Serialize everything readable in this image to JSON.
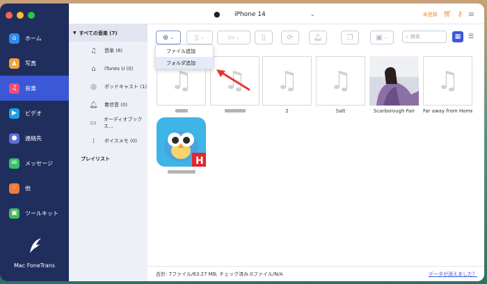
{
  "app": {
    "name": "Mac FoneTrans"
  },
  "device": {
    "name": "iPhone 14"
  },
  "topbar": {
    "unregistered": "未登録"
  },
  "nav": {
    "items": [
      {
        "label": "ホーム",
        "color": "#2f8bf0"
      },
      {
        "label": "写真",
        "color": "#f2a33a"
      },
      {
        "label": "音楽",
        "color": "#ec4f79"
      },
      {
        "label": "ビデオ",
        "color": "#1aa0e8"
      },
      {
        "label": "連絡先",
        "color": "#5b6ed8"
      },
      {
        "label": "メッセージ",
        "color": "#36c06b"
      },
      {
        "label": "他",
        "color": "#f27a3a"
      },
      {
        "label": "ツールキット",
        "color": "#43b85c"
      }
    ],
    "active_index": 2
  },
  "category": {
    "header": "すべての音楽 (7)",
    "items": [
      {
        "label": "音楽 (6)",
        "icon": "music-note-icon"
      },
      {
        "label": "iTunes U (0)",
        "icon": "graduation-cap-icon"
      },
      {
        "label": "ポッドキャスト (1)",
        "icon": "podcast-icon"
      },
      {
        "label": "着信音 (0)",
        "icon": "bell-icon"
      },
      {
        "label": "オーディオブックス...",
        "icon": "audiobook-icon"
      },
      {
        "label": "ボイスメモ (0)",
        "icon": "voice-memo-icon"
      }
    ],
    "playlist": "プレイリスト"
  },
  "add_menu": {
    "items": [
      "ファイル追加",
      "フォルダ追加"
    ],
    "highlighted_index": 1
  },
  "search": {
    "placeholder": "検索"
  },
  "tracks": [
    {
      "title": "",
      "art": "none",
      "title_hidden": true
    },
    {
      "title": "",
      "art": "none",
      "title_hidden": true
    },
    {
      "title": "2",
      "art": "none"
    },
    {
      "title": "Salt",
      "art": "none"
    },
    {
      "title": "Scarborough Fair",
      "art": "album-cover"
    },
    {
      "title": "Far away from Home",
      "art": "none"
    },
    {
      "title": "",
      "art": "app-icon",
      "title_hidden": true
    }
  ],
  "status": {
    "summary": "合計: 7ファイル/63.27 MB; チェック済み:0ファイル/N/A",
    "lost_link": "データが消えました？"
  },
  "colors": {
    "sidebar": "#202e5e",
    "accent": "#3b58d6",
    "annotation_arrow": "#e8352e",
    "unregistered": "#f08a2a"
  }
}
